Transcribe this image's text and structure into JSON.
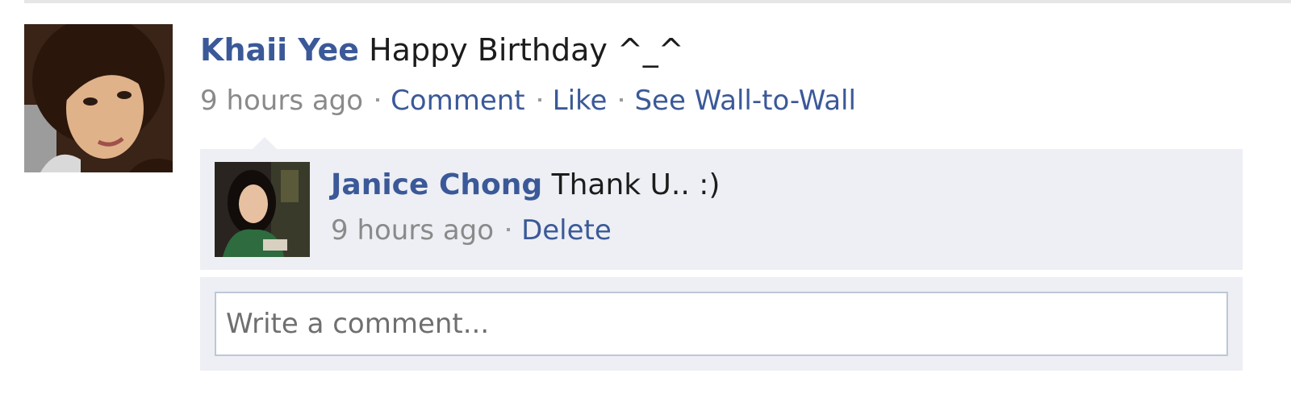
{
  "post": {
    "actor_name": "Khaii Yee",
    "message": "Happy Birthday ^_^",
    "timestamp": "9 hours ago",
    "actions": {
      "comment": "Comment",
      "like": "Like",
      "wall_to_wall": "See Wall-to-Wall"
    }
  },
  "comments": [
    {
      "author": "Janice Chong",
      "text": "Thank U.. :)",
      "timestamp": "9 hours ago",
      "delete_label": "Delete"
    }
  ],
  "comment_form": {
    "placeholder": "Write a comment..."
  },
  "colors": {
    "link": "#3b5998",
    "muted_text": "#8a8a8a",
    "comment_bg": "#edeff4",
    "input_border": "#bdc7d8"
  },
  "icons": {
    "post_avatar": "profile-photo-khaii-yee",
    "comment_avatar": "profile-photo-janice-chong"
  }
}
